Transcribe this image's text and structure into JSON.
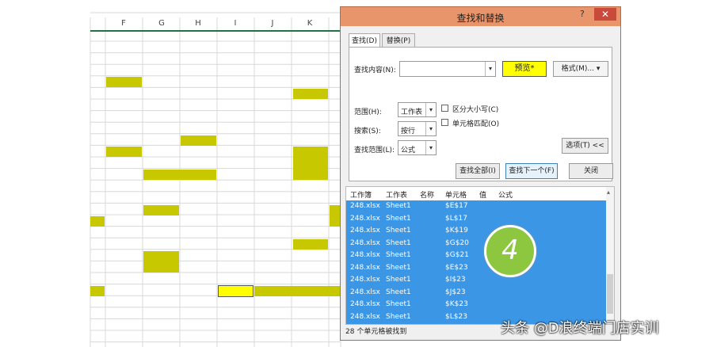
{
  "sheet": {
    "columns": [
      "F",
      "G",
      "H",
      "I",
      "J",
      "K"
    ]
  },
  "dialog": {
    "title": "查找和替换",
    "help": "?",
    "close": "✕",
    "tabs": [
      "查找(D)",
      "替换(P)"
    ],
    "find_label": "查找内容(N):",
    "find_value": "",
    "preview_button": "预览*",
    "format_button": "格式(M)...",
    "scope_label": "范围(H):",
    "scope_value": "工作表",
    "search_label": "搜索(S):",
    "search_value": "按行",
    "lookin_label": "查找范围(L):",
    "lookin_value": "公式",
    "match_case": "区分大小写(C)",
    "match_cell": "单元格匹配(O)",
    "options_button": "选项(T) <<",
    "find_all_button": "查找全部(I)",
    "find_next_button": "查找下一个(F)",
    "close_button": "关闭",
    "results_headers": [
      "工作簿",
      "工作表",
      "名称",
      "单元格",
      "值",
      "公式"
    ],
    "results": [
      {
        "book": "248.xlsx",
        "sheet": "Sheet1",
        "cell": "$E$17"
      },
      {
        "book": "248.xlsx",
        "sheet": "Sheet1",
        "cell": "$L$17"
      },
      {
        "book": "248.xlsx",
        "sheet": "Sheet1",
        "cell": "$K$19"
      },
      {
        "book": "248.xlsx",
        "sheet": "Sheet1",
        "cell": "$G$20"
      },
      {
        "book": "248.xlsx",
        "sheet": "Sheet1",
        "cell": "$G$21"
      },
      {
        "book": "248.xlsx",
        "sheet": "Sheet1",
        "cell": "$E$23"
      },
      {
        "book": "248.xlsx",
        "sheet": "Sheet1",
        "cell": "$I$23"
      },
      {
        "book": "248.xlsx",
        "sheet": "Sheet1",
        "cell": "$J$23"
      },
      {
        "book": "248.xlsx",
        "sheet": "Sheet1",
        "cell": "$K$23"
      },
      {
        "book": "248.xlsx",
        "sheet": "Sheet1",
        "cell": "$L$23"
      }
    ],
    "status": "28 个单元格被找到"
  },
  "badge": "4",
  "watermark": "头条 @D浪终端门店实训",
  "colors": {
    "highlight": "#c8c800",
    "titlebar": "#e9956b",
    "selection": "#3c96e6",
    "badge": "#8dc63f"
  }
}
